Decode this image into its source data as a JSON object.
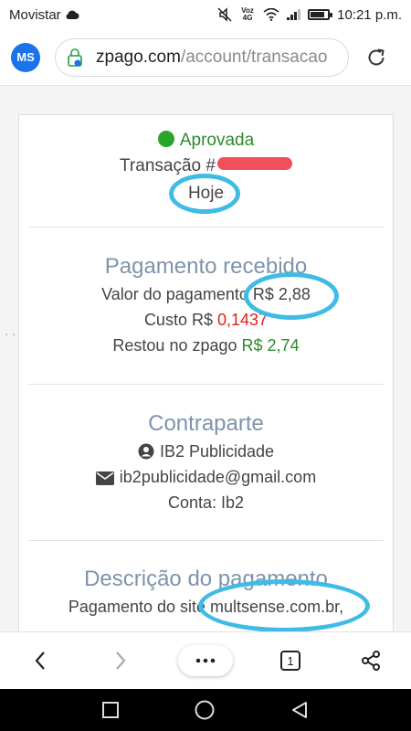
{
  "status_bar": {
    "carrier": "Movistar",
    "volte": "Voz 4G",
    "time": "10:21 p.m.",
    "battery_level": 0.85
  },
  "browser": {
    "avatar_initials": "MS",
    "url_host": "zpago.com",
    "url_path": "/account/transacao",
    "tab_count": "1"
  },
  "transaction": {
    "status": "Aprovada",
    "transaction_label": "Transação #",
    "date": "Hoje"
  },
  "payment": {
    "heading": "Pagamento recebido",
    "amount_label": "Valor do pagamento",
    "amount_value": "R$ 2,88",
    "cost_label": "Custo R$",
    "cost_value": "0,1437",
    "remaining_label": "Restou no zpago",
    "remaining_value": "R$ 2,74"
  },
  "counterpart": {
    "heading": "Contraparte",
    "name": "IB2 Publicidade",
    "email": "ib2publicidade@gmail.com",
    "account": "Conta: Ib2"
  },
  "description": {
    "heading": "Descrição do pagamento",
    "text_prefix": "Pagamento do site",
    "site": "multsense.com.br,"
  },
  "colors": {
    "accent_green": "#2aa52a",
    "cost_red": "#e0201b",
    "heading_blue": "#7e93ab",
    "annotation_blue": "#3fbbe6",
    "redaction_red": "#f0505a"
  }
}
